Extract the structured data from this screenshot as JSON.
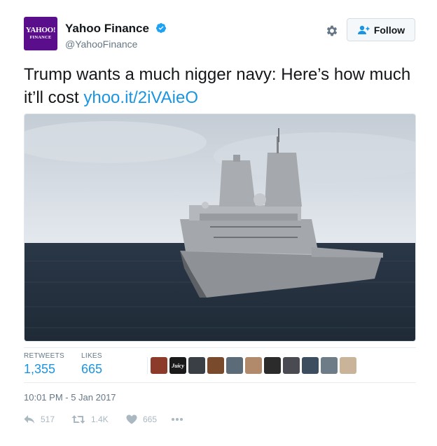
{
  "account": {
    "logo_line1": "YAHOO!",
    "logo_line2": "FINANCE",
    "name": "Yahoo Finance",
    "handle": "@YahooFinance"
  },
  "follow_label": "Follow",
  "tweet": {
    "text": "Trump wants a much nigger navy: Here’s how much it’ll cost ",
    "link": "yhoo.it/2iVAieO"
  },
  "stats": {
    "retweets_label": "RETWEETS",
    "retweets_value": "1,355",
    "likes_label": "LIKES",
    "likes_value": "665"
  },
  "likers": [
    {
      "icon": "liker-avatar-1",
      "color": "#8c3a2a"
    },
    {
      "icon": "liker-avatar-juicy",
      "color": "#1a1a1a",
      "text": "Juicy"
    },
    {
      "icon": "liker-avatar-3",
      "color": "#3a3f46"
    },
    {
      "icon": "liker-avatar-4",
      "color": "#7a4a2c"
    },
    {
      "icon": "liker-avatar-5",
      "color": "#5c6b78"
    },
    {
      "icon": "liker-avatar-6",
      "color": "#b08a6a"
    },
    {
      "icon": "liker-avatar-7",
      "color": "#2b2b2b"
    },
    {
      "icon": "liker-avatar-8",
      "color": "#4a4a52"
    },
    {
      "icon": "liker-avatar-9",
      "color": "#3b4d5e"
    },
    {
      "icon": "liker-avatar-10",
      "color": "#6d7c86"
    },
    {
      "icon": "liker-avatar-11",
      "color": "#c9b49a"
    }
  ],
  "timestamp": "10:01 PM - 5 Jan 2017",
  "actions": {
    "reply_count": "517",
    "retweet_count": "1.4K",
    "like_count": "665"
  },
  "icons": {
    "verified": "verified-badge-icon",
    "gear": "gear-icon",
    "follow": "add-user-icon",
    "reply": "reply-icon",
    "retweet": "retweet-icon",
    "like": "heart-icon",
    "more": "more-icon"
  },
  "colors": {
    "link": "#1b95e0",
    "avatar_bg": "#5a0e8c",
    "muted": "#657786"
  }
}
